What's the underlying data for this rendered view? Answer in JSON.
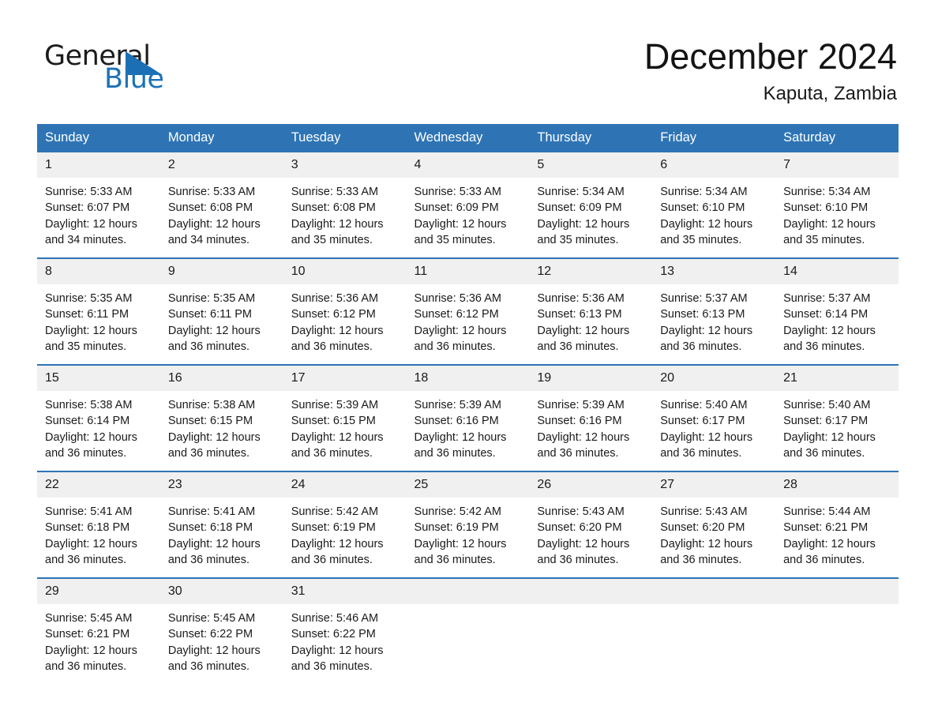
{
  "brand": {
    "word1": "General",
    "word2": "Blue",
    "triangle_color": "#1b6fb5"
  },
  "header": {
    "month_title": "December 2024",
    "location": "Kaputa, Zambia"
  },
  "theme": {
    "header_blue": "#2e74b5",
    "daynum_band": "#f0f0f0",
    "text": "#1a1a1a"
  },
  "calendar": {
    "weekday_headers": [
      "Sunday",
      "Monday",
      "Tuesday",
      "Wednesday",
      "Thursday",
      "Friday",
      "Saturday"
    ],
    "weeks": [
      [
        {
          "day": "1",
          "sunrise": "Sunrise: 5:33 AM",
          "sunset": "Sunset: 6:07 PM",
          "daylight_1": "Daylight: 12 hours",
          "daylight_2": "and 34 minutes."
        },
        {
          "day": "2",
          "sunrise": "Sunrise: 5:33 AM",
          "sunset": "Sunset: 6:08 PM",
          "daylight_1": "Daylight: 12 hours",
          "daylight_2": "and 34 minutes."
        },
        {
          "day": "3",
          "sunrise": "Sunrise: 5:33 AM",
          "sunset": "Sunset: 6:08 PM",
          "daylight_1": "Daylight: 12 hours",
          "daylight_2": "and 35 minutes."
        },
        {
          "day": "4",
          "sunrise": "Sunrise: 5:33 AM",
          "sunset": "Sunset: 6:09 PM",
          "daylight_1": "Daylight: 12 hours",
          "daylight_2": "and 35 minutes."
        },
        {
          "day": "5",
          "sunrise": "Sunrise: 5:34 AM",
          "sunset": "Sunset: 6:09 PM",
          "daylight_1": "Daylight: 12 hours",
          "daylight_2": "and 35 minutes."
        },
        {
          "day": "6",
          "sunrise": "Sunrise: 5:34 AM",
          "sunset": "Sunset: 6:10 PM",
          "daylight_1": "Daylight: 12 hours",
          "daylight_2": "and 35 minutes."
        },
        {
          "day": "7",
          "sunrise": "Sunrise: 5:34 AM",
          "sunset": "Sunset: 6:10 PM",
          "daylight_1": "Daylight: 12 hours",
          "daylight_2": "and 35 minutes."
        }
      ],
      [
        {
          "day": "8",
          "sunrise": "Sunrise: 5:35 AM",
          "sunset": "Sunset: 6:11 PM",
          "daylight_1": "Daylight: 12 hours",
          "daylight_2": "and 35 minutes."
        },
        {
          "day": "9",
          "sunrise": "Sunrise: 5:35 AM",
          "sunset": "Sunset: 6:11 PM",
          "daylight_1": "Daylight: 12 hours",
          "daylight_2": "and 36 minutes."
        },
        {
          "day": "10",
          "sunrise": "Sunrise: 5:36 AM",
          "sunset": "Sunset: 6:12 PM",
          "daylight_1": "Daylight: 12 hours",
          "daylight_2": "and 36 minutes."
        },
        {
          "day": "11",
          "sunrise": "Sunrise: 5:36 AM",
          "sunset": "Sunset: 6:12 PM",
          "daylight_1": "Daylight: 12 hours",
          "daylight_2": "and 36 minutes."
        },
        {
          "day": "12",
          "sunrise": "Sunrise: 5:36 AM",
          "sunset": "Sunset: 6:13 PM",
          "daylight_1": "Daylight: 12 hours",
          "daylight_2": "and 36 minutes."
        },
        {
          "day": "13",
          "sunrise": "Sunrise: 5:37 AM",
          "sunset": "Sunset: 6:13 PM",
          "daylight_1": "Daylight: 12 hours",
          "daylight_2": "and 36 minutes."
        },
        {
          "day": "14",
          "sunrise": "Sunrise: 5:37 AM",
          "sunset": "Sunset: 6:14 PM",
          "daylight_1": "Daylight: 12 hours",
          "daylight_2": "and 36 minutes."
        }
      ],
      [
        {
          "day": "15",
          "sunrise": "Sunrise: 5:38 AM",
          "sunset": "Sunset: 6:14 PM",
          "daylight_1": "Daylight: 12 hours",
          "daylight_2": "and 36 minutes."
        },
        {
          "day": "16",
          "sunrise": "Sunrise: 5:38 AM",
          "sunset": "Sunset: 6:15 PM",
          "daylight_1": "Daylight: 12 hours",
          "daylight_2": "and 36 minutes."
        },
        {
          "day": "17",
          "sunrise": "Sunrise: 5:39 AM",
          "sunset": "Sunset: 6:15 PM",
          "daylight_1": "Daylight: 12 hours",
          "daylight_2": "and 36 minutes."
        },
        {
          "day": "18",
          "sunrise": "Sunrise: 5:39 AM",
          "sunset": "Sunset: 6:16 PM",
          "daylight_1": "Daylight: 12 hours",
          "daylight_2": "and 36 minutes."
        },
        {
          "day": "19",
          "sunrise": "Sunrise: 5:39 AM",
          "sunset": "Sunset: 6:16 PM",
          "daylight_1": "Daylight: 12 hours",
          "daylight_2": "and 36 minutes."
        },
        {
          "day": "20",
          "sunrise": "Sunrise: 5:40 AM",
          "sunset": "Sunset: 6:17 PM",
          "daylight_1": "Daylight: 12 hours",
          "daylight_2": "and 36 minutes."
        },
        {
          "day": "21",
          "sunrise": "Sunrise: 5:40 AM",
          "sunset": "Sunset: 6:17 PM",
          "daylight_1": "Daylight: 12 hours",
          "daylight_2": "and 36 minutes."
        }
      ],
      [
        {
          "day": "22",
          "sunrise": "Sunrise: 5:41 AM",
          "sunset": "Sunset: 6:18 PM",
          "daylight_1": "Daylight: 12 hours",
          "daylight_2": "and 36 minutes."
        },
        {
          "day": "23",
          "sunrise": "Sunrise: 5:41 AM",
          "sunset": "Sunset: 6:18 PM",
          "daylight_1": "Daylight: 12 hours",
          "daylight_2": "and 36 minutes."
        },
        {
          "day": "24",
          "sunrise": "Sunrise: 5:42 AM",
          "sunset": "Sunset: 6:19 PM",
          "daylight_1": "Daylight: 12 hours",
          "daylight_2": "and 36 minutes."
        },
        {
          "day": "25",
          "sunrise": "Sunrise: 5:42 AM",
          "sunset": "Sunset: 6:19 PM",
          "daylight_1": "Daylight: 12 hours",
          "daylight_2": "and 36 minutes."
        },
        {
          "day": "26",
          "sunrise": "Sunrise: 5:43 AM",
          "sunset": "Sunset: 6:20 PM",
          "daylight_1": "Daylight: 12 hours",
          "daylight_2": "and 36 minutes."
        },
        {
          "day": "27",
          "sunrise": "Sunrise: 5:43 AM",
          "sunset": "Sunset: 6:20 PM",
          "daylight_1": "Daylight: 12 hours",
          "daylight_2": "and 36 minutes."
        },
        {
          "day": "28",
          "sunrise": "Sunrise: 5:44 AM",
          "sunset": "Sunset: 6:21 PM",
          "daylight_1": "Daylight: 12 hours",
          "daylight_2": "and 36 minutes."
        }
      ],
      [
        {
          "day": "29",
          "sunrise": "Sunrise: 5:45 AM",
          "sunset": "Sunset: 6:21 PM",
          "daylight_1": "Daylight: 12 hours",
          "daylight_2": "and 36 minutes."
        },
        {
          "day": "30",
          "sunrise": "Sunrise: 5:45 AM",
          "sunset": "Sunset: 6:22 PM",
          "daylight_1": "Daylight: 12 hours",
          "daylight_2": "and 36 minutes."
        },
        {
          "day": "31",
          "sunrise": "Sunrise: 5:46 AM",
          "sunset": "Sunset: 6:22 PM",
          "daylight_1": "Daylight: 12 hours",
          "daylight_2": "and 36 minutes."
        },
        {
          "day": "",
          "sunrise": "",
          "sunset": "",
          "daylight_1": "",
          "daylight_2": ""
        },
        {
          "day": "",
          "sunrise": "",
          "sunset": "",
          "daylight_1": "",
          "daylight_2": ""
        },
        {
          "day": "",
          "sunrise": "",
          "sunset": "",
          "daylight_1": "",
          "daylight_2": ""
        },
        {
          "day": "",
          "sunrise": "",
          "sunset": "",
          "daylight_1": "",
          "daylight_2": ""
        }
      ]
    ]
  }
}
